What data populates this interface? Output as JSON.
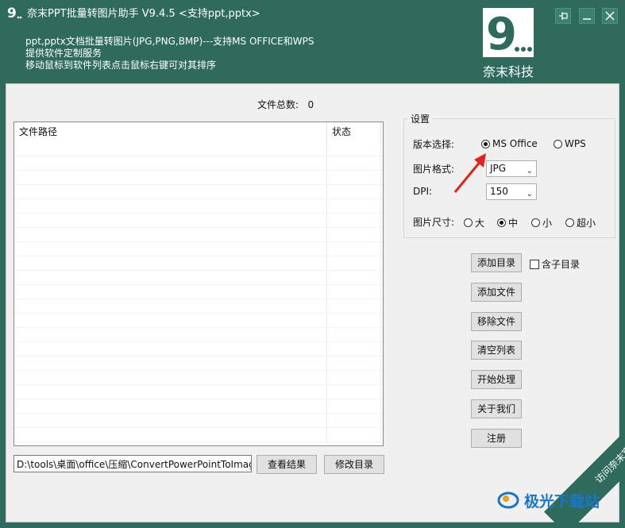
{
  "app": {
    "title": "奈末PPT批量转图片助手   V9.4.5  <支持ppt,pptx>",
    "desc1": "ppt,pptx文档批量转图片(JPG,PNG,BMP)---支持MS OFFICE和WPS",
    "desc2": "提供软件定制服务",
    "desc3": "移动鼠标到软件列表点击鼠标右键可对其排序",
    "brand": "奈末科技",
    "logo_text": "9..."
  },
  "window_controls": {
    "pin": "pin-icon",
    "minimize": "minimize-icon",
    "close": "close-icon"
  },
  "file_list": {
    "total_label": "文件总数:",
    "total_value": "0",
    "columns": [
      "文件路径",
      "状态"
    ],
    "rows": []
  },
  "output_path": "D:\\tools\\桌面\\office\\压缩\\ConvertPowerPointToImage",
  "buttons": {
    "view_result": "查看结果",
    "modify_dir": "修改目录",
    "add_dir": "添加目录",
    "add_file": "添加文件",
    "remove_file": "移除文件",
    "clear_list": "清空列表",
    "start": "开始处理",
    "about": "关于我们",
    "register": "注册"
  },
  "include_subdir": {
    "label": "含子目录",
    "checked": false
  },
  "settings": {
    "title": "设置",
    "version_label": "版本选择:",
    "version_options": [
      "MS Office",
      "WPS"
    ],
    "version_selected": "MS Office",
    "format_label": "图片格式:",
    "format_value": "JPG",
    "dpi_label": "DPI:",
    "dpi_value": "150",
    "size_label": "图片尺寸:",
    "size_options": [
      "大",
      "中",
      "小",
      "超小"
    ],
    "size_selected": "中"
  },
  "watermark": {
    "band_text": "访问奈末官网",
    "brand_text": "极光下载站"
  },
  "colors": {
    "accent": "#2f6b5c",
    "annotation_arrow": "#e0231c"
  }
}
